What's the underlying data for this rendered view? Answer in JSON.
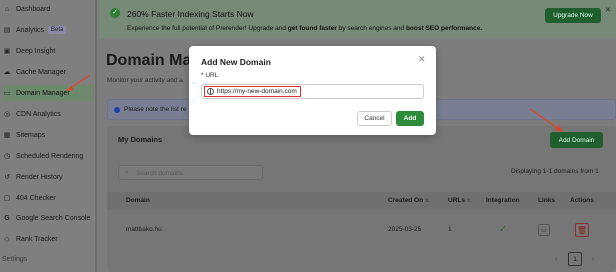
{
  "sidebar": {
    "items": [
      {
        "label": "Dashboard",
        "icon": "dashboard-icon"
      },
      {
        "label": "Analytics",
        "icon": "analytics-icon",
        "badge": "Beta"
      },
      {
        "label": "Deep Insight",
        "icon": "insight-icon"
      },
      {
        "label": "Cache Manager",
        "icon": "cloud-icon"
      },
      {
        "label": "Domain Manager",
        "icon": "domain-icon",
        "active": true
      },
      {
        "label": "CDN Analytics",
        "icon": "globe-icon"
      },
      {
        "label": "Sitemaps",
        "icon": "sitemap-icon"
      },
      {
        "label": "Scheduled Rendering",
        "icon": "clock-icon"
      },
      {
        "label": "Render History",
        "icon": "history-icon"
      },
      {
        "label": "404 Checker",
        "icon": "checker-icon"
      },
      {
        "label": "Google Search Console",
        "icon": "google-icon"
      },
      {
        "label": "Rank Tracker",
        "icon": "tag-icon"
      }
    ],
    "settings_label": "Settings"
  },
  "banner": {
    "title": "260% Faster Indexing Starts Now",
    "sub_prefix": "Experience the full potential of Prerender! Upgrade and ",
    "sub_bold1": "get found faster",
    "sub_mid": " by search engines and ",
    "sub_bold2": "boost SEO performance.",
    "upgrade_label": "Upgrade Now",
    "close_glyph": "✕"
  },
  "page": {
    "title": "Domain Mana",
    "subtitle": "Monitor your activity and a",
    "notice": "Please note the list re"
  },
  "domains": {
    "title": "My Domains",
    "add_label": "Add Domain",
    "search_placeholder": "Search domains",
    "count_text": "Displaying 1-1 domains from 1",
    "columns": {
      "domain": "Domain",
      "created": "Created On",
      "urls": "URLs",
      "integration": "Integration",
      "links": "Links",
      "actions": "Actions"
    },
    "rows": [
      {
        "domain": "mattbako.hu",
        "created": "2025-03-25",
        "urls": "1",
        "integration": "✓"
      }
    ],
    "page_number": "1"
  },
  "modal": {
    "title": "Add New Domain",
    "field_label": "URL",
    "required_mark": "*",
    "url_value": "https://my-new-domain.com",
    "cancel_label": "Cancel",
    "add_label": "Add"
  },
  "colors": {
    "primary_green": "#2e8b3a",
    "annotation_arrow": "#e0442a"
  }
}
